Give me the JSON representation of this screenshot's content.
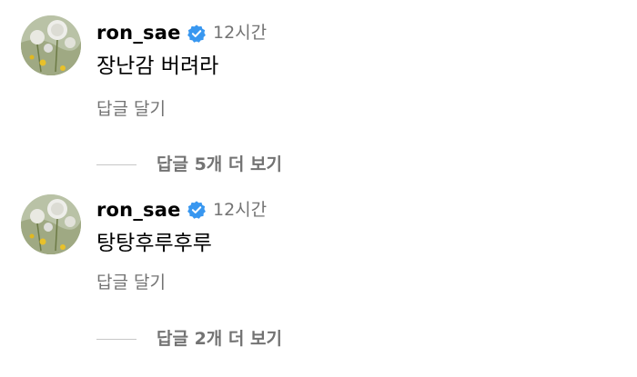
{
  "comments": [
    {
      "username": "ron_sae",
      "time": "12시간",
      "text": "장난감 버려라",
      "reply_label": "답글 달기",
      "view_replies_label": "답글 5개 더 보기"
    },
    {
      "username": "ron_sae",
      "time": "12시간",
      "text": "탕탕후루후루",
      "reply_label": "답글 달기",
      "view_replies_label": "답글 2개 더 보기"
    }
  ],
  "colors": {
    "verified": "#3897f0",
    "secondary_text": "#737373",
    "primary_text": "#000000"
  },
  "icons": {
    "verified": "verified-badge-icon",
    "avatar": "profile-photo-dandelion"
  }
}
